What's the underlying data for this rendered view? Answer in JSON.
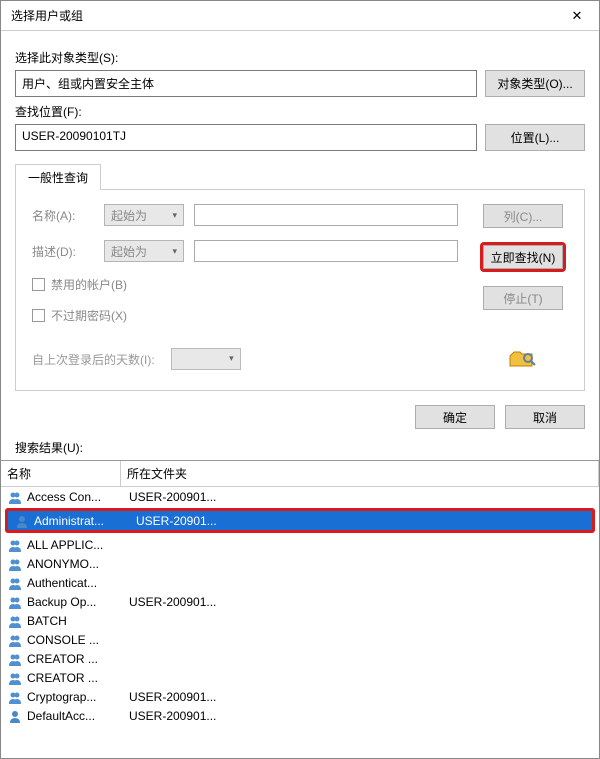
{
  "window": {
    "title": "选择用户或组",
    "close": "✕"
  },
  "sections": {
    "objectType": {
      "label": "选择此对象类型(S):",
      "value": "用户、组或内置安全主体",
      "button": "对象类型(O)..."
    },
    "location": {
      "label": "查找位置(F):",
      "value": "USER-20090101TJ",
      "button": "位置(L)..."
    }
  },
  "tab": {
    "label": "一般性查询"
  },
  "query": {
    "name": {
      "label": "名称(A):",
      "combo": "起始为",
      "value": ""
    },
    "desc": {
      "label": "描述(D):",
      "combo": "起始为",
      "value": ""
    },
    "cbDisabled": "禁用的帐户(B)",
    "cbNoExpire": "不过期密码(X)",
    "daysLabel": "自上次登录后的天数(I):"
  },
  "sideButtons": {
    "columns": "列(C)...",
    "findNow": "立即查找(N)",
    "stop": "停止(T)"
  },
  "okcancel": {
    "ok": "确定",
    "cancel": "取消"
  },
  "resultsLabel": "搜索结果(U):",
  "columns": {
    "name": "名称",
    "folder": "所在文件夹"
  },
  "rows": [
    {
      "name": "Access Con...",
      "folder": "USER-200901...",
      "type": "group",
      "selected": false,
      "highlight": false
    },
    {
      "name": "Administrat...",
      "folder": "USER-20901...",
      "type": "user",
      "selected": true,
      "highlight": true
    },
    {
      "name": "ALL APPLIC...",
      "folder": "",
      "type": "group",
      "selected": false,
      "highlight": false
    },
    {
      "name": "ANONYMO...",
      "folder": "",
      "type": "group",
      "selected": false,
      "highlight": false
    },
    {
      "name": "Authenticat...",
      "folder": "",
      "type": "group",
      "selected": false,
      "highlight": false
    },
    {
      "name": "Backup Op...",
      "folder": "USER-200901...",
      "type": "group",
      "selected": false,
      "highlight": false
    },
    {
      "name": "BATCH",
      "folder": "",
      "type": "group",
      "selected": false,
      "highlight": false
    },
    {
      "name": "CONSOLE ...",
      "folder": "",
      "type": "group",
      "selected": false,
      "highlight": false
    },
    {
      "name": "CREATOR ...",
      "folder": "",
      "type": "group",
      "selected": false,
      "highlight": false
    },
    {
      "name": "CREATOR ...",
      "folder": "",
      "type": "group",
      "selected": false,
      "highlight": false
    },
    {
      "name": "Cryptograp...",
      "folder": "USER-200901...",
      "type": "group",
      "selected": false,
      "highlight": false
    },
    {
      "name": "DefaultAcc...",
      "folder": "USER-200901...",
      "type": "user",
      "selected": false,
      "highlight": false
    }
  ]
}
